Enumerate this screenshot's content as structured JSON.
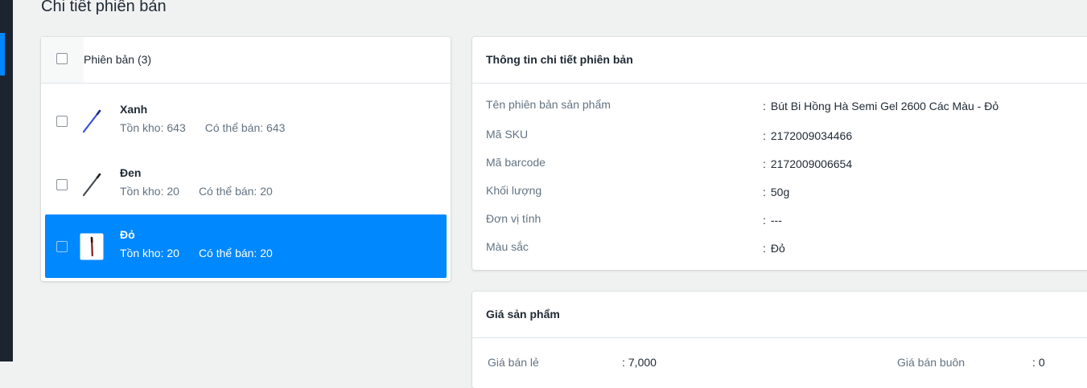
{
  "page": {
    "title": "Chi tiết phiên bản"
  },
  "variants": {
    "header_label": "Phiên bản (3)",
    "items": [
      {
        "name": "Xanh",
        "stock_label": "Tồn kho: 643",
        "available_label": "Có thể bán: 643",
        "color": "#3b4fd8",
        "thumb_icon": "blue-pen-icon"
      },
      {
        "name": "Đen",
        "stock_label": "Tồn kho: 20",
        "available_label": "Có thể bán: 20",
        "color": "#444b52",
        "thumb_icon": "black-pen-icon"
      },
      {
        "name": "Đỏ",
        "stock_label": "Tồn kho: 20",
        "available_label": "Có thể bán: 20",
        "color": "#7a1f1f",
        "thumb_icon": "red-pen-icon",
        "selected": true
      }
    ]
  },
  "details": {
    "title": "Thông tin chi tiết phiên bản",
    "rows": [
      {
        "label": "Tên phiên bản sản phẩm",
        "value": "Bút Bi Hồng Hà Semi Gel 2600 Các Màu - Đỏ"
      },
      {
        "label": "Mã SKU",
        "value": "2172009034466"
      },
      {
        "label": "Mã barcode",
        "value": "2172009006654"
      },
      {
        "label": "Khối lượng",
        "value": "50g"
      },
      {
        "label": "Đơn vị tính",
        "value": "---"
      },
      {
        "label": "Màu sắc",
        "value": "Đỏ"
      }
    ]
  },
  "pricing": {
    "title": "Giá sản phẩm",
    "retail_label": "Giá bán lẻ",
    "retail_value": "7,000",
    "wholesale_label": "Giá bán buôn",
    "wholesale_value": "0"
  },
  "colors": {
    "accent": "#0088ff",
    "sidebar": "#1c2430",
    "background": "#f0f1f1"
  }
}
